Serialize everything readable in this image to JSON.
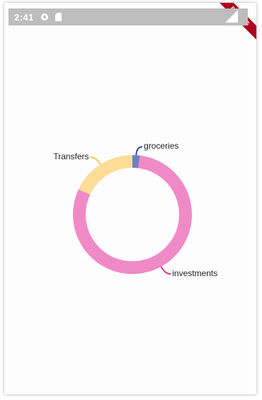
{
  "status_bar": {
    "time": "2:41",
    "icons": [
      "gear-icon",
      "sd-card-icon",
      "signal-icon"
    ]
  },
  "debug_banner": "DEBUG",
  "chart_data": {
    "type": "pie",
    "style": "donut",
    "slices": [
      {
        "label": "groceries",
        "value": 2,
        "color": "#6f7fc9",
        "leader_color": "#3949ab"
      },
      {
        "label": "investments",
        "value": 80,
        "color": "#f08ac7",
        "leader_color": "#d6357f"
      },
      {
        "label": "Transfers",
        "value": 18,
        "color": "#fddc98",
        "leader_color": "#f4c35a"
      }
    ]
  }
}
